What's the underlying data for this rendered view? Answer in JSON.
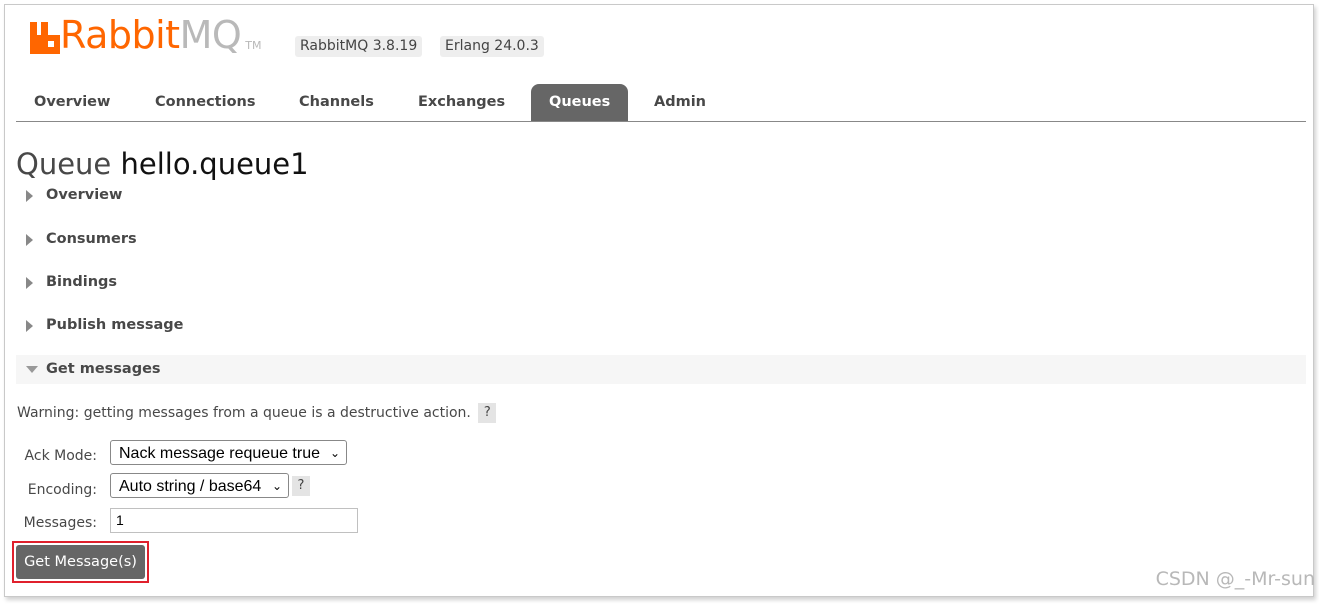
{
  "header": {
    "logo_rabbit": "Rabbit",
    "logo_mq": "MQ",
    "logo_tm": "TM",
    "rabbitmq_version": "RabbitMQ 3.8.19",
    "erlang_version": "Erlang 24.0.3"
  },
  "tabs": [
    {
      "label": "Overview",
      "active": false
    },
    {
      "label": "Connections",
      "active": false
    },
    {
      "label": "Channels",
      "active": false
    },
    {
      "label": "Exchanges",
      "active": false
    },
    {
      "label": "Queues",
      "active": true
    },
    {
      "label": "Admin",
      "active": false
    }
  ],
  "page": {
    "title_prefix": "Queue",
    "queue_name": "hello.queue1"
  },
  "sections": [
    {
      "label": "Overview",
      "expanded": false
    },
    {
      "label": "Consumers",
      "expanded": false
    },
    {
      "label": "Bindings",
      "expanded": false
    },
    {
      "label": "Publish message",
      "expanded": false
    },
    {
      "label": "Get messages",
      "expanded": true
    }
  ],
  "get_messages": {
    "warning": "Warning: getting messages from a queue is a destructive action.",
    "help_symbol": "?",
    "ack_mode_label": "Ack Mode:",
    "ack_mode_value": "Nack message requeue true",
    "encoding_label": "Encoding:",
    "encoding_value": "Auto string / base64",
    "messages_label": "Messages:",
    "messages_value": "1",
    "button_label": "Get Message(s)"
  },
  "watermark": "CSDN @_-Mr-sun",
  "colors": {
    "brand_orange": "#ff6600",
    "tab_active_bg": "#666666",
    "highlight_red": "#e0202c"
  }
}
